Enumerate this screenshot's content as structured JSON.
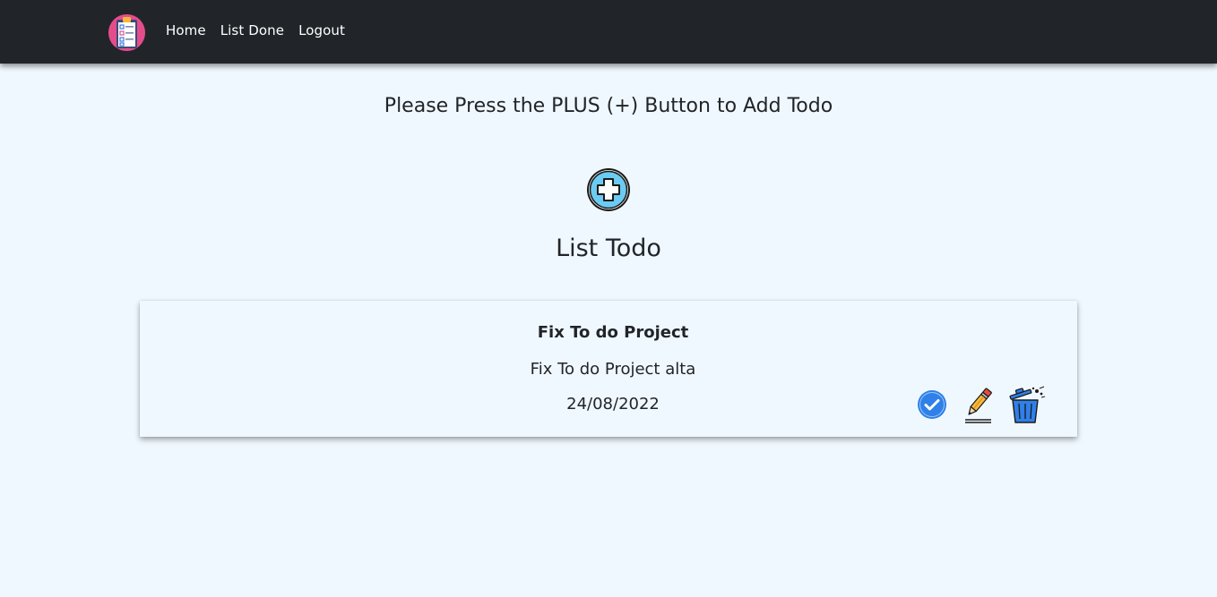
{
  "navbar": {
    "logo_icon": "clipboard-checklist-icon",
    "links": [
      {
        "label": "Home"
      },
      {
        "label": "List Done"
      },
      {
        "label": "Logout"
      }
    ],
    "colors": {
      "background": "#212529",
      "text": "#ffffff",
      "logo_bg": "#e44d8b"
    }
  },
  "main": {
    "instruction": "Please Press the PLUS (+) Button to Add Todo",
    "add_button_icon": "plus-circle-icon",
    "list_title": "List Todo",
    "background": "#f0f8ff"
  },
  "todos": [
    {
      "title": "Fix To do Project",
      "description": "Fix To do Project alta",
      "date": "24/08/2022",
      "actions": {
        "done_icon": "check-circle-icon",
        "edit_icon": "pencil-icon",
        "delete_icon": "trash-icon"
      }
    }
  ]
}
